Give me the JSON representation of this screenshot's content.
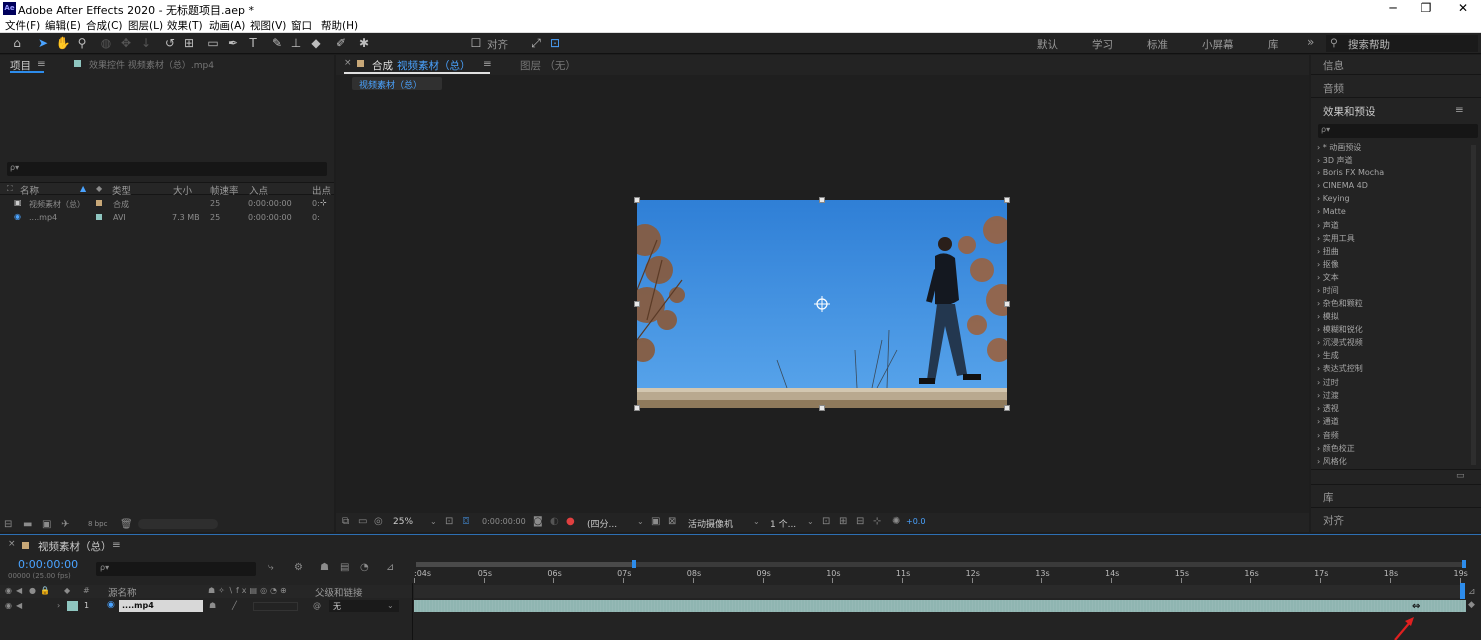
{
  "window": {
    "title": "Adobe After Effects 2020 - 无标题项目.aep *",
    "app_icon": "Ae",
    "min": "─",
    "restore": "❐",
    "close": "✕"
  },
  "menu": [
    "文件(F)",
    "编辑(E)",
    "合成(C)",
    "图层(L)",
    "效果(T)",
    "动画(A)",
    "视图(V)",
    "窗口",
    "帮助(H)"
  ],
  "toolbar": {
    "align_label": "对齐",
    "workspaces": [
      "默认",
      "学习",
      "标准",
      "小屏幕",
      "库"
    ],
    "more": "»",
    "search_help": "搜索帮助"
  },
  "project": {
    "tab_label": "项目",
    "effects_tab": "效果控件 视频素材（总）.mp4",
    "search_placeholder": "ρ▾",
    "columns": [
      "名称",
      "类型",
      "大小",
      "帧速率",
      "入点",
      "出点"
    ],
    "rows": [
      {
        "name": "视频素材（总）",
        "type": "合成",
        "size": "",
        "fps": "25",
        "in": "0:00:00:00",
        "out": "0:"
      },
      {
        "name": "....mp4",
        "type": "AVI",
        "size": "7.3 MB",
        "fps": "25",
        "in": "0:00:00:00",
        "out": "0:"
      }
    ],
    "bpc": "8 bpc"
  },
  "composition": {
    "tab_prefix": "合成",
    "tab_name": "视频素材（总）",
    "layer_tab": "图层 （无）",
    "breadcrumb": "视频素材（总）",
    "zoom": "25%",
    "timecode": "0:00:00:00",
    "resolution": "(四分...",
    "camera": "活动摄像机",
    "views": "1 个...",
    "exposure": "+0.0"
  },
  "right_panel": {
    "info": "信息",
    "audio": "音频",
    "effects_title": "效果和预设",
    "effects": [
      "* 动画预设",
      "3D 声道",
      "Boris FX Mocha",
      "CINEMA 4D",
      "Keying",
      "Matte",
      "声道",
      "实用工具",
      "扭曲",
      "抠像",
      "文本",
      "时间",
      "杂色和颗粒",
      "模拟",
      "模糊和锐化",
      "沉浸式视频",
      "生成",
      "表达式控制",
      "过时",
      "过渡",
      "透视",
      "通道",
      "音频",
      "颜色校正",
      "风格化"
    ],
    "library": "库",
    "align": "对齐"
  },
  "timeline": {
    "tab_name": "视频素材（总）",
    "timecode": "0:00:00:00",
    "fps_info": "00000 (25.00 fps)",
    "search_placeholder": "ρ▾",
    "col_source": "源名称",
    "col_parent": "父级和链接",
    "layer_num": "1",
    "layer_name": "....mp4",
    "parent_value": "无",
    "ruler": [
      ":04s",
      "05s",
      "06s",
      "07s",
      "08s",
      "09s",
      "10s",
      "11s",
      "12s",
      "13s",
      "14s",
      "15s",
      "16s",
      "17s",
      "18s",
      "19s"
    ]
  },
  "colors": {
    "accent": "#2d8ceb",
    "layer_bar": "#8fb5b1",
    "sky": "#3d8edc"
  }
}
